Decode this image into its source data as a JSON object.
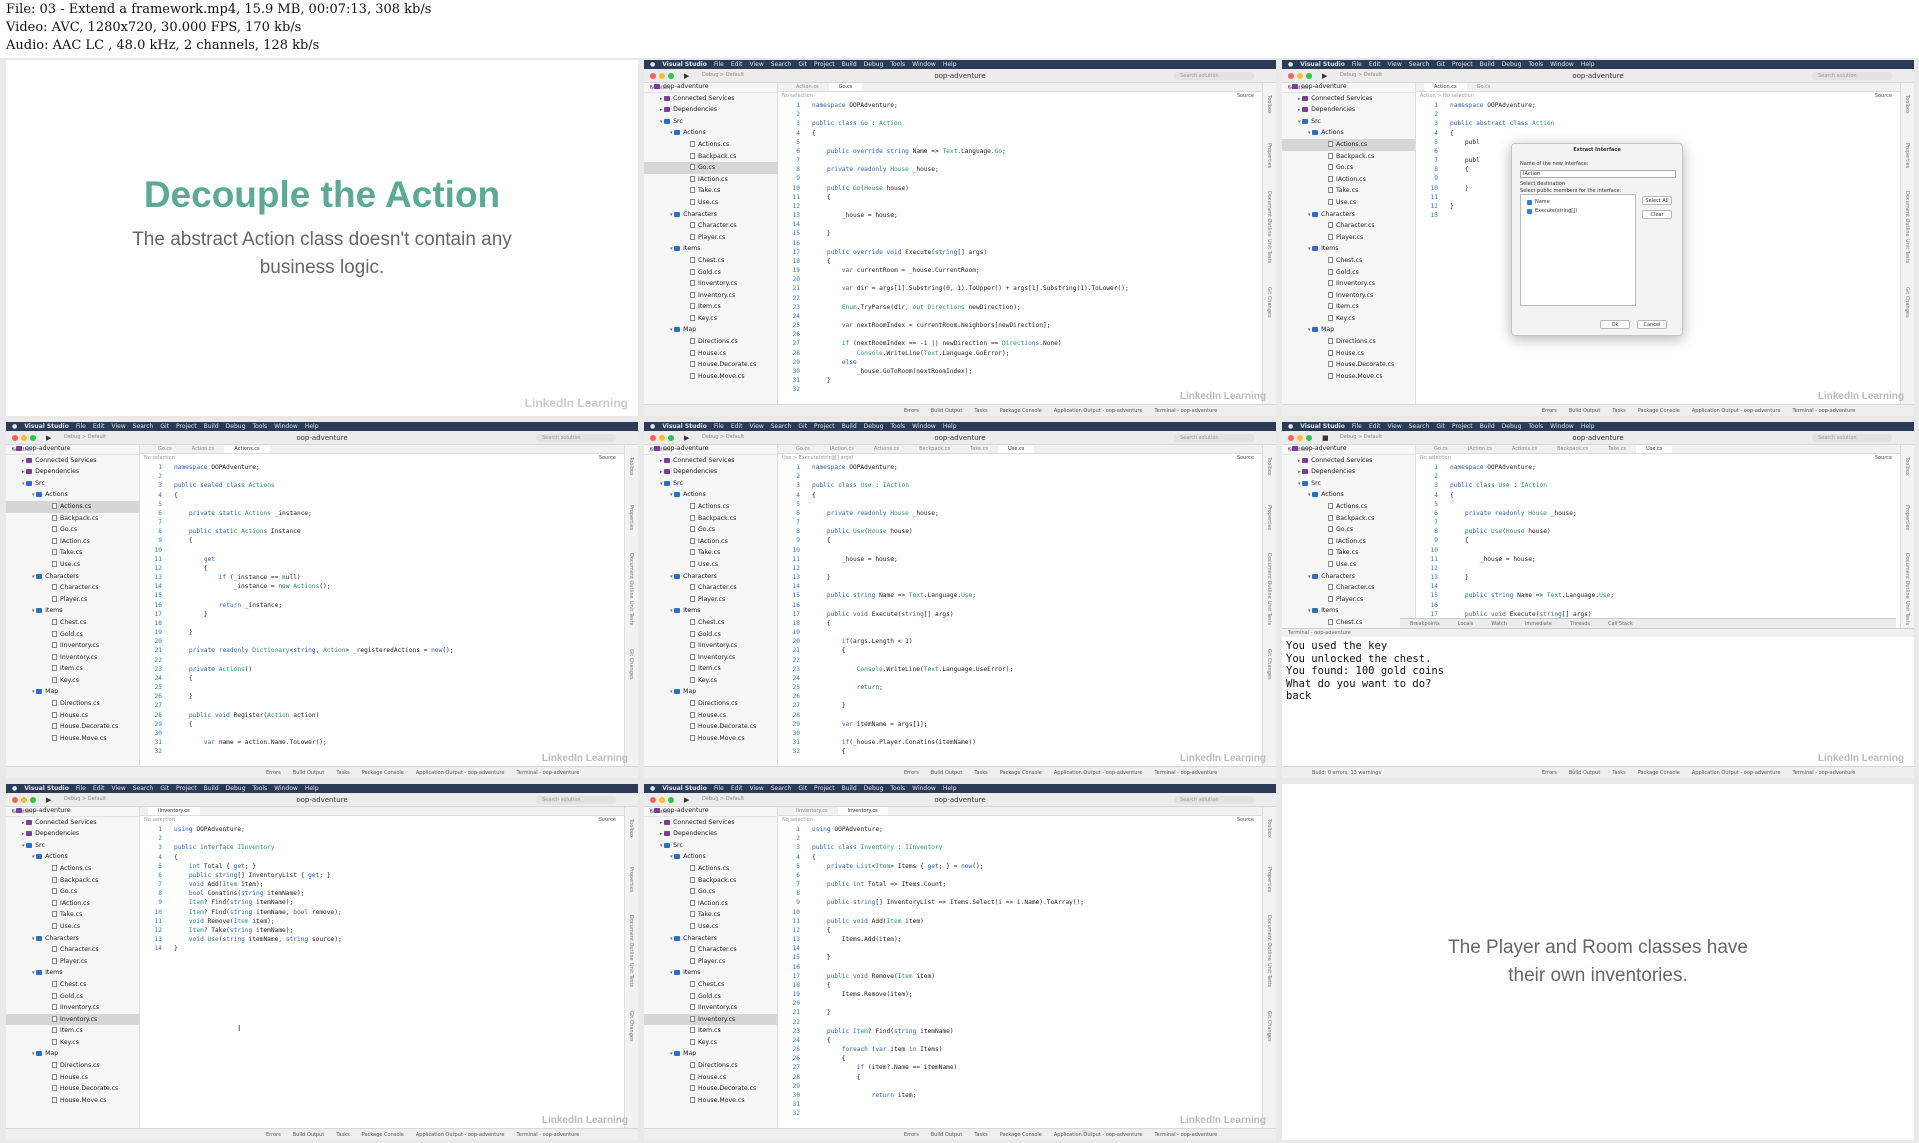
{
  "header": {
    "lines": [
      "File: 03 - Extend a framework.mp4, 15.9 MB, 00:07:13, 308 kb/s",
      "Video: AVC, 1280x720, 30.000 FPS, 170 kb/s",
      "Audio: AAC LC , 48.0 kHz, 2 channels, 128 kb/s"
    ]
  },
  "common": {
    "app_name": "Visual Studio",
    "menu": [
      "File",
      "Edit",
      "View",
      "Search",
      "Git",
      "Project",
      "Build",
      "Debug",
      "Tools",
      "Window",
      "Help"
    ],
    "window_title": "oop-adventure",
    "run_config": "Debug  >  Default",
    "search_placeholder": "Search solution",
    "solution_label": "Solution",
    "no_selection": "No selection",
    "source_label": "Source",
    "status_items": [
      "Errors",
      "Build Output",
      "Tasks",
      "Package Console",
      "Application Output - oop-adventure",
      "Terminal - oop-adventure"
    ],
    "watermark": "LinkedIn Learning",
    "side_tabs": [
      "Toolbox",
      "Properties",
      "Document Outline",
      "Unit Tests",
      "Git Changes"
    ],
    "tree": [
      {
        "label": "oop-adventure",
        "type": "special",
        "level": 0
      },
      {
        "label": "Connected Services",
        "type": "special",
        "level": 1
      },
      {
        "label": "Dependencies",
        "type": "special",
        "level": 1
      },
      {
        "label": "Src",
        "type": "folder",
        "level": 1
      },
      {
        "label": "Actions",
        "type": "folder",
        "level": 2
      },
      {
        "label": "Actions.cs",
        "type": "file",
        "level": 3
      },
      {
        "label": "Backpack.cs",
        "type": "file",
        "level": 3
      },
      {
        "label": "Go.cs",
        "type": "file",
        "level": 3
      },
      {
        "label": "IAction.cs",
        "type": "file",
        "level": 3
      },
      {
        "label": "Take.cs",
        "type": "file",
        "level": 3
      },
      {
        "label": "Use.cs",
        "type": "file",
        "level": 3
      },
      {
        "label": "Characters",
        "type": "folder",
        "level": 2
      },
      {
        "label": "Character.cs",
        "type": "file",
        "level": 3
      },
      {
        "label": "Player.cs",
        "type": "file",
        "level": 3
      },
      {
        "label": "Items",
        "type": "folder",
        "level": 2
      },
      {
        "label": "Chest.cs",
        "type": "file",
        "level": 3
      },
      {
        "label": "Gold.cs",
        "type": "file",
        "level": 3
      },
      {
        "label": "IInventory.cs",
        "type": "file",
        "level": 3
      },
      {
        "label": "Inventory.cs",
        "type": "file",
        "level": 3
      },
      {
        "label": "Item.cs",
        "type": "file",
        "level": 3
      },
      {
        "label": "Key.cs",
        "type": "file",
        "level": 3
      },
      {
        "label": "Map",
        "type": "folder",
        "level": 2
      },
      {
        "label": "Directions.cs",
        "type": "file",
        "level": 3
      },
      {
        "label": "House.cs",
        "type": "file",
        "level": 3
      },
      {
        "label": "House.Decorate.cs",
        "type": "file",
        "level": 3
      },
      {
        "label": "House.Move.cs",
        "type": "file",
        "level": 3
      }
    ]
  },
  "slide1": {
    "title": "Decouple the Action",
    "subtitle": "The abstract Action class doesn't contain any business logic."
  },
  "slide2": {
    "text": "The Player and Room classes have their own inventories."
  },
  "frames": [
    {
      "tabs": [
        "Action.cs",
        "Go.cs"
      ],
      "active_tab": 1,
      "selected": "Go.cs",
      "breadcrumb": "No selection",
      "code": [
        "namespace OOPAdventure;",
        "",
        "public class Go : Action",
        "{",
        "",
        "    public override string Name => Text.Language.Go;",
        "",
        "    private readonly House _house;",
        "",
        "    public Go(House house)",
        "    {",
        "",
        "        _house = house;",
        "",
        "    }",
        "",
        "    public override void Execute(string[] args)",
        "    {",
        "        var currentRoom = _house.CurrentRoom;",
        "",
        "        var dir = args[1].Substring(0, 1).ToUpper() + args[1].Substring(1).ToLower();",
        "",
        "        Enum.TryParse(dir, out Directions newDirection);",
        "",
        "        var nextRoomIndex = currentRoom.Neighbors[newDirection];",
        "",
        "        if (nextRoomIndex == -1 || newDirection == Directions.None)",
        "            Console.WriteLine(Text.Language.GoError);",
        "        else",
        "            _house.GoToRoom(nextRoomIndex);",
        "    }",
        ""
      ]
    },
    {
      "tabs": [
        "Action.cs",
        "Go.cs"
      ],
      "active_tab": 0,
      "selected": "Actions.cs",
      "breadcrumb": "Action  >  No selection",
      "code": [
        "namespace OOPAdventure;",
        "",
        "public abstract class Action",
        "{",
        "    publ",
        "",
        "    publ",
        "    {",
        "",
        "    }",
        "",
        "}",
        ""
      ],
      "dialog": {
        "title": "Extract Interface",
        "name_label": "Name of the new interface:",
        "name_value": "IAction",
        "dest_label": "Select destination",
        "members_label": "Select public members for the interface:",
        "members": [
          "Name",
          "Execute(string[])"
        ],
        "select_all": "Select All",
        "clear": "Clear",
        "ok": "Ok",
        "cancel": "Cancel"
      }
    },
    {
      "tabs": [
        "Go.cs",
        "Action.cs",
        "Actions.cs"
      ],
      "active_tab": 2,
      "selected": "Actions.cs",
      "breadcrumb": "No selection",
      "code": [
        "namespace OOPAdventure;",
        "",
        "public sealed class Actions",
        "{",
        "",
        "    private static Actions _instance;",
        "",
        "    public static Actions Instance",
        "    {",
        "",
        "        get",
        "        {",
        "            if (_instance == null)",
        "                _instance = new Actions();",
        "",
        "            return _instance;",
        "        }",
        "",
        "    }",
        "",
        "    private readonly Dictionary<string, Action> _registeredActions = new();",
        "",
        "    private Actions()",
        "    {",
        "",
        "    }",
        "",
        "    public void Register(Action action)",
        "    {",
        "",
        "        var name = action.Name.ToLower();",
        ""
      ]
    },
    {
      "tabs": [
        "Go.cs",
        "IAction.cs",
        "Actions.cs",
        "Backpack.cs",
        "Take.cs",
        "Use.cs"
      ],
      "active_tab": 5,
      "selected": "",
      "breadcrumb": "Use  >  Execute(string[] args)",
      "code": [
        "namespace OOPAdventure;",
        "",
        "public class Use : IAction",
        "{",
        "",
        "    private readonly House _house;",
        "",
        "    public Use(House house)",
        "    {",
        "",
        "        _house = house;",
        "",
        "    }",
        "",
        "    public string Name => Text.Language.Use;",
        "",
        "    public void Execute(string[] args)",
        "    {",
        "",
        "        if(args.Length < 1)",
        "        {",
        "",
        "            Console.WriteLine(Text.Language.UseError);",
        "",
        "            return;",
        "",
        "        }",
        "",
        "        var itemName = args[1];",
        "",
        "        if(_house.Player.Conatins(itemName))",
        "        {"
      ]
    },
    {
      "tabs": [
        "Go.cs",
        "IAction.cs",
        "Actions.cs",
        "Backpack.cs",
        "Take.cs",
        "Use.cs"
      ],
      "active_tab": 5,
      "selected": "",
      "breadcrumb": "No selection",
      "code": [
        "namespace OOPAdventure;",
        "",
        "public class Use : IAction",
        "{",
        "",
        "    private readonly House _house;",
        "",
        "    public Use(House house)",
        "    {",
        "",
        "        _house = house;",
        "",
        "    }",
        "",
        "    public string Name => Text.Language.Use;",
        "",
        "    public void Execute(string[] args)",
        "    {",
        "",
        "        if(args.Length < 1)"
      ],
      "debug_tabs": [
        "Breakpoints",
        "Locals",
        "Watch",
        "Immediate",
        "Threads",
        "Call Stack"
      ],
      "terminal_title": "Terminal - oop-adventure",
      "terminal_lines": [
        "You used the key",
        "You unlocked the chest.",
        "You found: 100 gold coins",
        "What do you want to do?",
        "back"
      ],
      "build_status": "Build: 0 errors, 13 warnings"
    },
    {
      "tabs": [
        "IInventory.cs"
      ],
      "active_tab": 0,
      "selected": "Inventory.cs",
      "breadcrumb": "No selection",
      "code": [
        "using OOPAdventure;",
        "",
        "public interface IInventory",
        "{",
        "    int Total { get; }",
        "    public string[] InventoryList { get; }",
        "    void Add(Item item);",
        "    bool Conatins(string itemName);",
        "    Item? Find(string itemName);",
        "    Item? Find(string itemName, bool remove);",
        "    void Remove(Item item);",
        "    Item? Take(string itemName);",
        "    void Use(string itemName, string source);",
        "}"
      ]
    },
    {
      "tabs": [
        "IInventory.cs",
        "Inventory.cs"
      ],
      "active_tab": 1,
      "selected": "Inventory.cs",
      "breadcrumb": "No selection",
      "code": [
        "using OOPAdventure;",
        "",
        "public class Inventory : IInventory",
        "{",
        "    private List<Item> Items { get; } = new();",
        "",
        "    public int Total => Items.Count;",
        "",
        "    public string[] InventoryList => Items.Select(i => i.Name).ToArray();",
        "",
        "    public void Add(Item item)",
        "    {",
        "        Items.Add(item);",
        "",
        "    }",
        "",
        "    public void Remove(Item item)",
        "    {",
        "        Items.Remove(item);",
        "",
        "    }",
        "",
        "    public Item? Find(string itemName)",
        "    {",
        "        foreach (var item in Items)",
        "        {",
        "            if (item?.Name == itemName)",
        "            {",
        "",
        "                return item;",
        "",
        ""
      ]
    }
  ]
}
